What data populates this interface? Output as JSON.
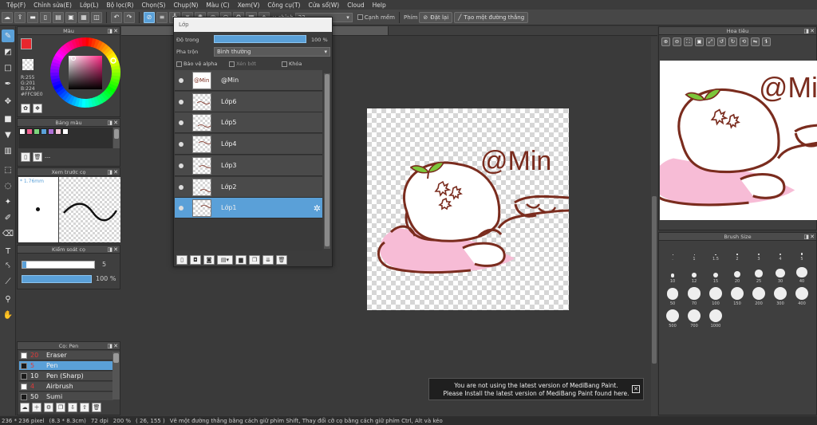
{
  "menu": [
    "Tệp(F)",
    "Chỉnh sửa(E)",
    "Lớp(L)",
    "Bộ lọc(R)",
    "Chọn(S)",
    "Chụp(N)",
    "Màu (C)",
    "Xem(V)",
    "Công cụ(T)",
    "Cửa sổ(W)",
    "Cloud",
    "Help"
  ],
  "toolbar": {
    "correction_label": "u chỉnh",
    "correction_value": "23",
    "edge_label": "Cạnh mềm",
    "hand_label": "Phím",
    "reset_label": "Đặt lại",
    "create_line_label": "Tạo một đường thẳng"
  },
  "color_panel": {
    "title": "Màu",
    "r": "R:255",
    "g": "G:201",
    "b": "B:224",
    "hex": "#FFC9E0",
    "fg_color": "#e8272e",
    "bg_color": "#ffffff"
  },
  "palette_panel": {
    "title": "Bảng màu",
    "swatches": [
      "#ffffff",
      "#f06292",
      "#7cd67c",
      "#5aa0d8",
      "#b071d8",
      "#f7c8da",
      "#ffffff"
    ],
    "footer_text": "---"
  },
  "brush_preview_panel": {
    "title": "Xem trước cọ",
    "size_label": "1.76mm"
  },
  "brush_control_panel": {
    "title": "Kiểm soát cọ",
    "size_value": "5",
    "opacity_value": "100 %"
  },
  "pen_panel": {
    "title": "Cọ: Pen",
    "items": [
      {
        "num": "20",
        "name": "Eraser",
        "color": "#ffffff",
        "num_red": true
      },
      {
        "num": "5",
        "name": "Pen",
        "color": "#1a1a1a",
        "num_red": true
      },
      {
        "num": "10",
        "name": "Pen (Sharp)",
        "color": "#1a1a1a",
        "num_red": false
      },
      {
        "num": "4",
        "name": "Airbrush",
        "color": "#ffffff",
        "num_red": true
      },
      {
        "num": "50",
        "name": "Sumi",
        "color": "#1a1a1a",
        "num_red": false
      }
    ]
  },
  "layer_panel": {
    "title": "Lớp",
    "opacity_label": "Độ trong",
    "opacity_value": "100 %",
    "blend_label": "Pha trộn",
    "blend_value": "Bình thường",
    "protect_alpha_label": "Bảo vệ alpha",
    "clipping_label": "Xén bớt",
    "lock_label": "Khóa",
    "layers": [
      {
        "name": "@Min",
        "thumb": "@Min"
      },
      {
        "name": "Lớp6",
        "thumb": ""
      },
      {
        "name": "Lớp5",
        "thumb": ""
      },
      {
        "name": "Lớp4",
        "thumb": ""
      },
      {
        "name": "Lớp3",
        "thumb": ""
      },
      {
        "name": "Lớp2",
        "thumb": ""
      },
      {
        "name": "Lớp1",
        "thumb": ""
      }
    ]
  },
  "canvas": {
    "watermark_text": "@Min"
  },
  "navigator_panel": {
    "title": "Hoa tiêu"
  },
  "brush_size_panel": {
    "title": "Brush Size",
    "sizes": [
      {
        "label": ".",
        "r": 0.4
      },
      {
        "label": "1",
        "r": 0.5
      },
      {
        "label": "1.5",
        "r": 0.6
      },
      {
        "label": "2",
        "r": 0.8
      },
      {
        "label": "3",
        "r": 1
      },
      {
        "label": "4",
        "r": 1.2
      },
      {
        "label": "5",
        "r": 1.4
      },
      {
        "label": "7",
        "r": 1.8
      },
      {
        "label": "10",
        "r": 2.4
      },
      {
        "label": "12",
        "r": 2.8
      },
      {
        "label": "15",
        "r": 3.2
      },
      {
        "label": "20",
        "r": 4
      },
      {
        "label": "25",
        "r": 4.8
      },
      {
        "label": "30",
        "r": 5.6
      },
      {
        "label": "40",
        "r": 6.6
      },
      {
        "label": "50",
        "r": 7.4
      },
      {
        "label": "70",
        "r": 7.8
      },
      {
        "label": "100",
        "r": 8
      },
      {
        "label": "150",
        "r": 8
      },
      {
        "label": "200",
        "r": 8
      },
      {
        "label": "300",
        "r": 8
      },
      {
        "label": "400",
        "r": 8
      },
      {
        "label": "500",
        "r": 8
      },
      {
        "label": "700",
        "r": 8
      },
      {
        "label": "1000",
        "r": 8
      }
    ]
  },
  "notice": {
    "line1": "You are not using the latest version of MediBang Paint.",
    "line2": "Please Install the latest version of MediBang Paint found here.",
    "close_label": "✕"
  },
  "status": {
    "dims": "236 * 236 pixel",
    "cm": "(8.3 * 8.3cm)",
    "dpi": "72 dpi",
    "zoom": "200 %",
    "coords": "( 26, 155 )",
    "hint": "Vẽ một đường thẳng bằng cách giữ phím Shift, Thay đổi cỡ cọ bằng cách giữ phím Ctrl, Alt và kéo"
  },
  "colors": {
    "accent": "#5aa0d8",
    "line_art": "#7a2c1e",
    "pink": "#f7bcd6",
    "leaf": "#7cc63a"
  }
}
